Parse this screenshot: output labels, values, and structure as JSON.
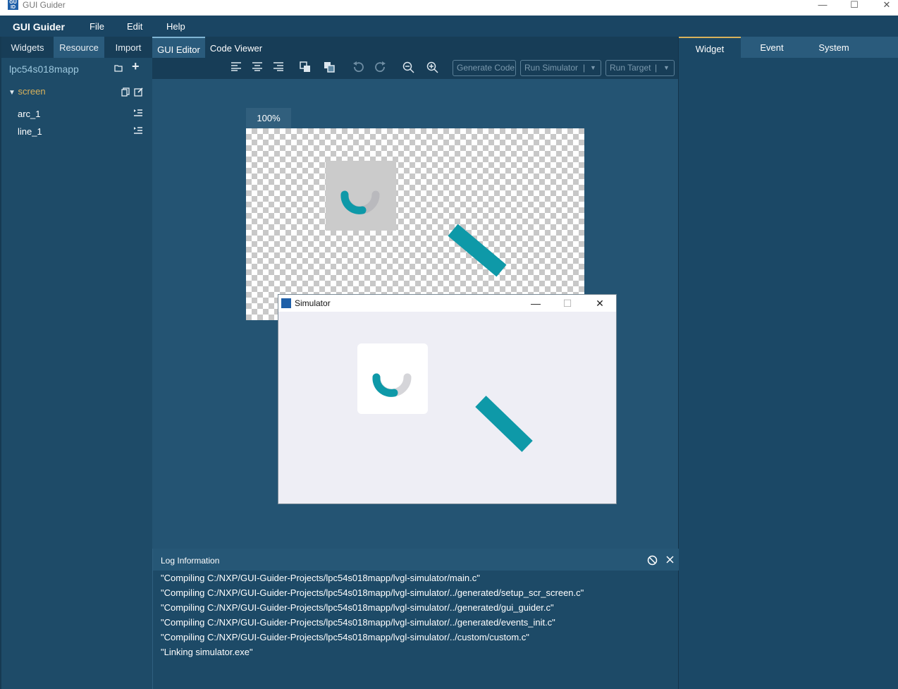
{
  "window": {
    "title": "GUI Guider",
    "minimize_glyph": "—",
    "maximize_glyph": "☐",
    "close_glyph": "✕"
  },
  "menu": {
    "app_name": "GUI Guider",
    "items": [
      "File",
      "Edit",
      "Help"
    ]
  },
  "left_panel": {
    "tabs": [
      "Widgets",
      "Resource",
      "Import"
    ],
    "project_name": "lpc54s018mapp",
    "tree": {
      "screen_label": "screen",
      "children": [
        "arc_1",
        "line_1"
      ]
    }
  },
  "center": {
    "tabs": [
      "GUI Editor",
      "Code Viewer"
    ],
    "toolbar": {
      "generate_code": "Generate Code",
      "run_simulator": "Run Simulator",
      "run_target": "Run Target"
    },
    "zoom": "100%"
  },
  "right_panel": {
    "tabs": [
      "Widget",
      "Event",
      "System"
    ]
  },
  "simulator": {
    "title": "Simulator",
    "minimize_glyph": "—",
    "maximize_glyph": "☐",
    "close_glyph": "✕"
  },
  "log": {
    "title": "Log Information",
    "lines": [
      "\"Compiling C:/NXP/GUI-Guider-Projects/lpc54s018mapp/lvgl-simulator/main.c\"",
      "\"Compiling C:/NXP/GUI-Guider-Projects/lpc54s018mapp/lvgl-simulator/../generated/setup_scr_screen.c\"",
      "\"Compiling C:/NXP/GUI-Guider-Projects/lpc54s018mapp/lvgl-simulator/../generated/gui_guider.c\"",
      "\"Compiling C:/NXP/GUI-Guider-Projects/lpc54s018mapp/lvgl-simulator/../generated/events_init.c\"",
      "\"Compiling C:/NXP/GUI-Guider-Projects/lpc54s018mapp/lvgl-simulator/../custom/custom.c\"",
      "\"Linking simulator.exe\""
    ]
  },
  "colors": {
    "accent_teal": "#0e99a8",
    "arc_bg": "#b9b9bd",
    "tab_highlight": "#d9b25b"
  }
}
